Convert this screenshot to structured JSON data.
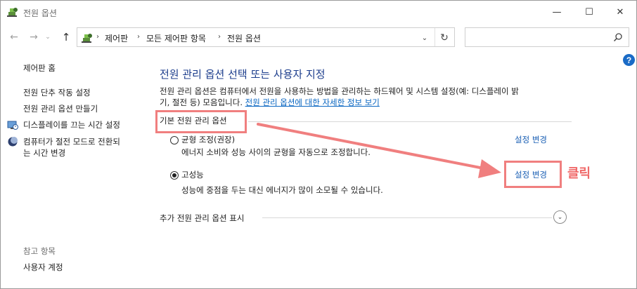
{
  "window": {
    "title": "전원 옵션",
    "minimize_glyph": "—",
    "maximize_glyph": "☐",
    "close_glyph": "✕"
  },
  "nav": {
    "back_glyph": "←",
    "forward_glyph": "→",
    "recent_glyph": "⌄",
    "up_glyph": "↑",
    "breadcrumb": [
      "제어판",
      "모든 제어판 항목",
      "전원 옵션"
    ],
    "breadcrumb_separator": "›",
    "dropdown_glyph": "⌄",
    "refresh_glyph": "↻"
  },
  "search": {
    "placeholder": ""
  },
  "help": {
    "glyph": "?"
  },
  "sidebar": {
    "home": "제어판 홈",
    "items": [
      {
        "label": "전원 단추 작동 설정"
      },
      {
        "label": "전원 관리 옵션 만들기"
      },
      {
        "label": "디스플레이를 끄는 시간 설정",
        "icon": "display-clock-icon"
      },
      {
        "label": "컴퓨터가 절전 모드로 전환되는 시간 변경",
        "line1": "컴퓨터가 절전 모드로 전환되",
        "line2": "는 시간 변경",
        "icon": "moon-icon"
      }
    ],
    "see_also_header": "참고 항목",
    "see_also": [
      "사용자 계정"
    ]
  },
  "main": {
    "title": "전원 관리 옵션 선택 또는 사용자 지정",
    "description_line1": "전원 관리 옵션은 컴퓨터에서 전원을 사용하는 방법을 관리하는 하드웨어 및 시스템 설정(예: 디스플레이 밝",
    "description_line2": "기, 절전 등) 모음입니다. ",
    "description_link": "전원 관리 옵션에 대한 자세한 정보 보기",
    "section_header": "기본 전원 관리 옵션",
    "plans": [
      {
        "name": "균형 조정(권장)",
        "description": "에너지 소비와 성능 사이의 균형을 자동으로 조정합니다.",
        "link": "설정 변경",
        "selected": false
      },
      {
        "name": "고성능",
        "description": "성능에 중점을 두는 대신 에너지가 많이 소모될 수 있습니다.",
        "link": "설정 변경",
        "selected": true
      }
    ],
    "more_plans": "추가 전원 관리 옵션 표시",
    "expand_glyph": "⌄"
  },
  "annotation": {
    "click_label": "클릭",
    "color": "#f07f7f"
  }
}
